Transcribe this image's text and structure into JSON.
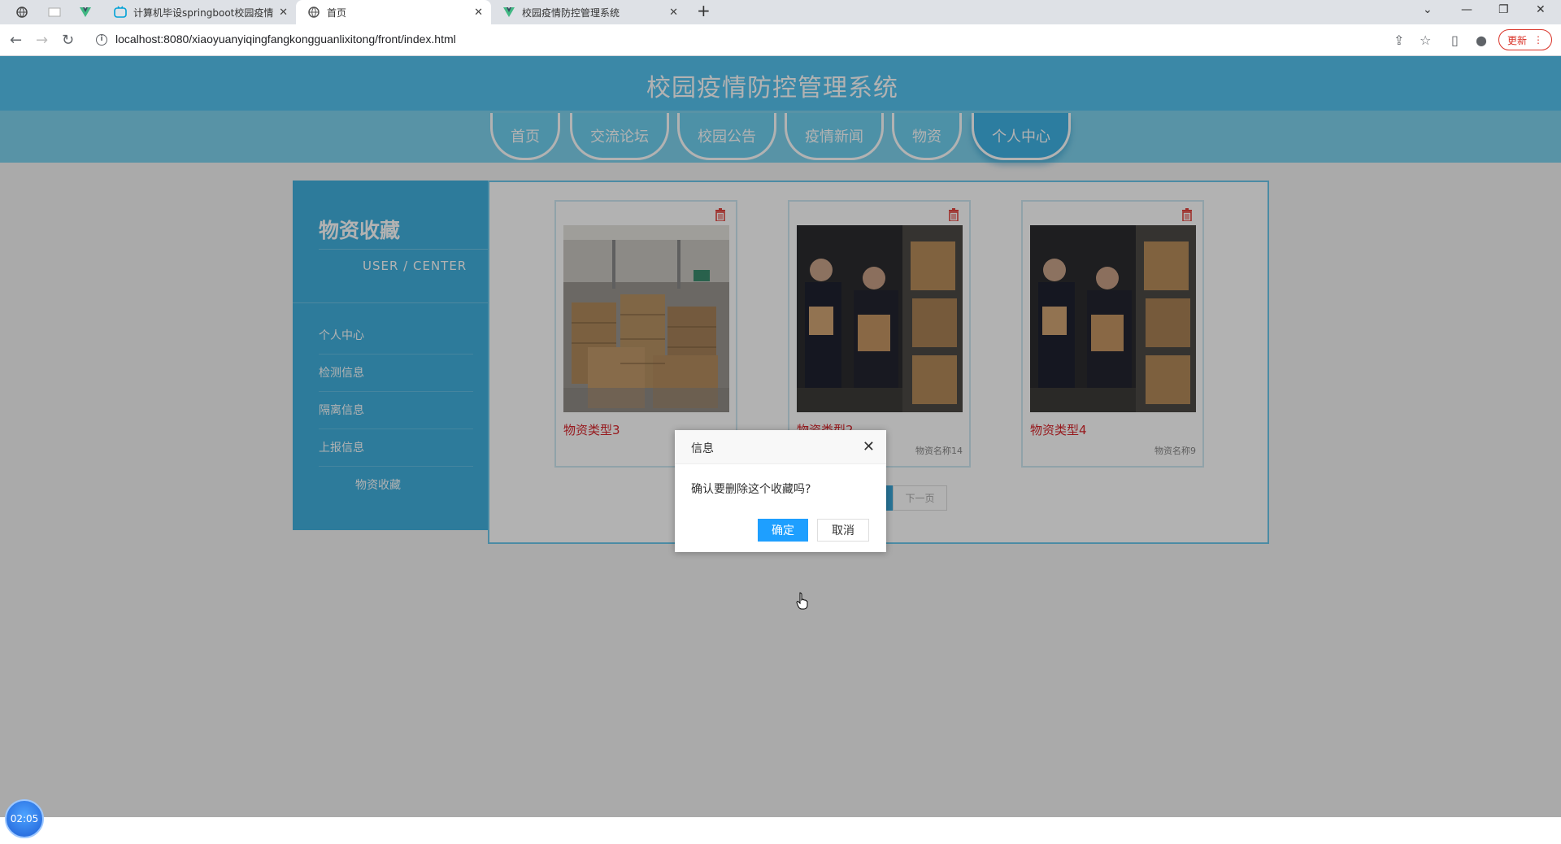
{
  "browser": {
    "tabs": [
      {
        "title": "计算机毕设springboot校园疫情",
        "active": false
      },
      {
        "title": "首页",
        "active": true
      },
      {
        "title": "校园疫情防控管理系统",
        "active": false
      }
    ],
    "url": "localhost:8080/xiaoyuanyiqingfangkongguanlixitong/front/index.html",
    "update_label": "更新"
  },
  "site": {
    "title": "校园疫情防控管理系统",
    "nav": [
      "首页",
      "交流论坛",
      "校园公告",
      "疫情新闻",
      "物资",
      "个人中心"
    ],
    "nav_active": "个人中心"
  },
  "sidebar": {
    "title": "物资收藏",
    "subtitle": "USER / CENTER",
    "items": [
      "个人中心",
      "检测信息",
      "隔离信息",
      "上报信息",
      "物资收藏"
    ]
  },
  "favorites": [
    {
      "type": "物资类型3",
      "name": ""
    },
    {
      "type": "物资类型2",
      "name": "物资名称14"
    },
    {
      "type": "物资类型4",
      "name": "物资名称9"
    }
  ],
  "pager": {
    "next": "下一页"
  },
  "dialog": {
    "title": "信息",
    "message": "确认要删除这个收藏吗?",
    "ok": "确定",
    "cancel": "取消"
  },
  "timer": "02:05"
}
